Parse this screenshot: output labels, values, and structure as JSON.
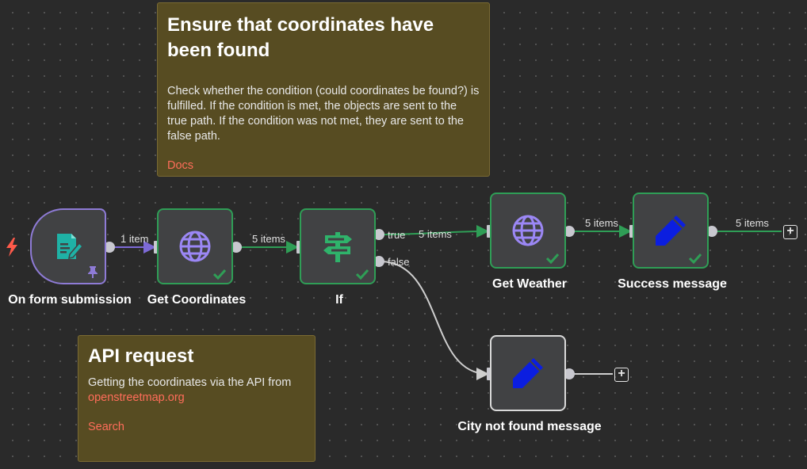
{
  "sticky_notes": {
    "coordinates": {
      "title": "Ensure that coordinates have been found",
      "body": "Check whether the condition (could coordinates be found?) is fulfilled. If the condition is met, the objects are sent to the true path. If the condition was not met, they are sent to the false path.",
      "link": "Docs"
    },
    "api": {
      "title": "API request",
      "body": "Getting the coordinates via the API from",
      "link": "openstreetmap.org",
      "link2": "Search"
    }
  },
  "nodes": {
    "trigger": {
      "label": "On form submission",
      "icon": "form-icon"
    },
    "get_coordinates": {
      "label": "Get Coordinates",
      "icon": "globe-icon"
    },
    "if": {
      "label": "If",
      "icon": "signpost-icon"
    },
    "get_weather": {
      "label": "Get Weather",
      "icon": "globe-icon"
    },
    "success": {
      "label": "Success message",
      "icon": "pencil-icon"
    },
    "not_found": {
      "label": "City not found message",
      "icon": "pencil-icon"
    }
  },
  "edges": {
    "trigger_to_coords": "1 item",
    "coords_to_if": "5 items",
    "if_true_branch": "true",
    "if_false_branch": "false",
    "true_to_weather": "5 items",
    "weather_to_success": "5 items",
    "success_out": "5 items"
  },
  "colors": {
    "success_border": "#2f9e56",
    "trigger_border": "#8e7bd6",
    "note_background": "#574c22",
    "link": "#ff6d5a",
    "pencil": "#0b1ee0",
    "globe": "#9b87f5",
    "signpost": "#2fb36b",
    "form": "#1fb2a6"
  }
}
